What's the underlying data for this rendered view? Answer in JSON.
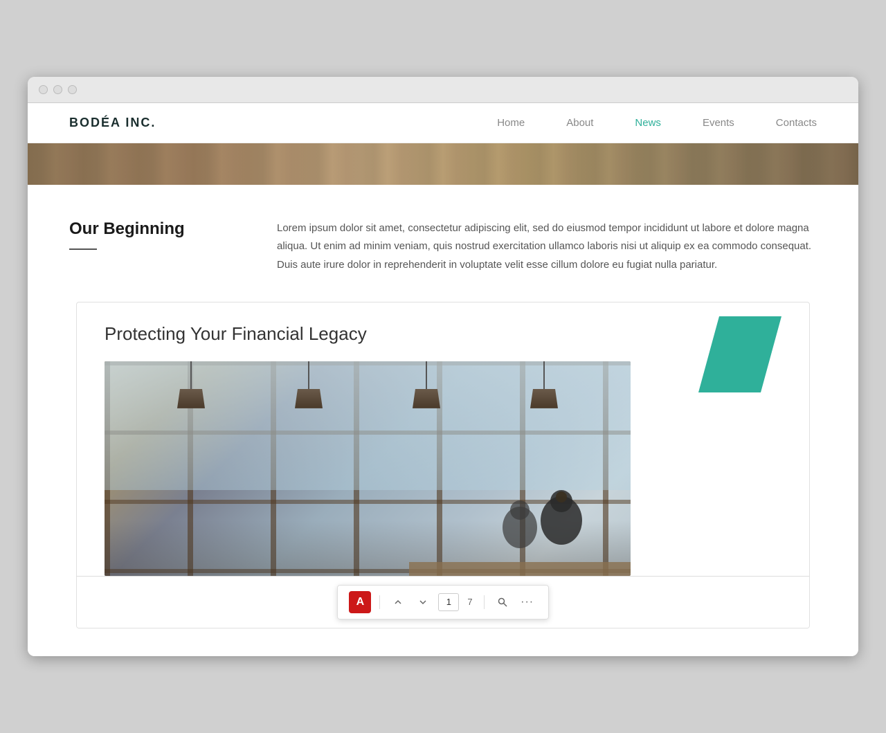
{
  "browser": {
    "traffic_lights": [
      "close",
      "minimize",
      "maximize"
    ]
  },
  "navbar": {
    "logo": "BODÉA INC.",
    "links": [
      {
        "id": "home",
        "label": "Home",
        "active": false
      },
      {
        "id": "about",
        "label": "About",
        "active": false
      },
      {
        "id": "news",
        "label": "News",
        "active": true
      },
      {
        "id": "events",
        "label": "Events",
        "active": false
      },
      {
        "id": "contacts",
        "label": "Contacts",
        "active": false
      }
    ]
  },
  "section": {
    "title": "Our Beginning",
    "body": "Lorem ipsum dolor sit amet, consectetur adipiscing elit, sed do eiusmod tempor incididunt ut labore et dolore magna aliqua. Ut enim ad minim veniam, quis nostrud exercitation ullamco laboris nisi ut aliquip ex ea commodo consequat. Duis aute irure dolor in reprehenderit in voluptate velit esse cillum dolore eu fugiat nulla pariatur."
  },
  "pdf_card": {
    "title": "Protecting Your Financial Legacy",
    "teal_color": "#2fb09a"
  },
  "pdf_toolbar": {
    "acrobat_label": "A",
    "page_current": "1",
    "page_total": "7",
    "prev_label": "▲",
    "next_label": "▼",
    "search_label": "🔍",
    "more_label": "···"
  }
}
